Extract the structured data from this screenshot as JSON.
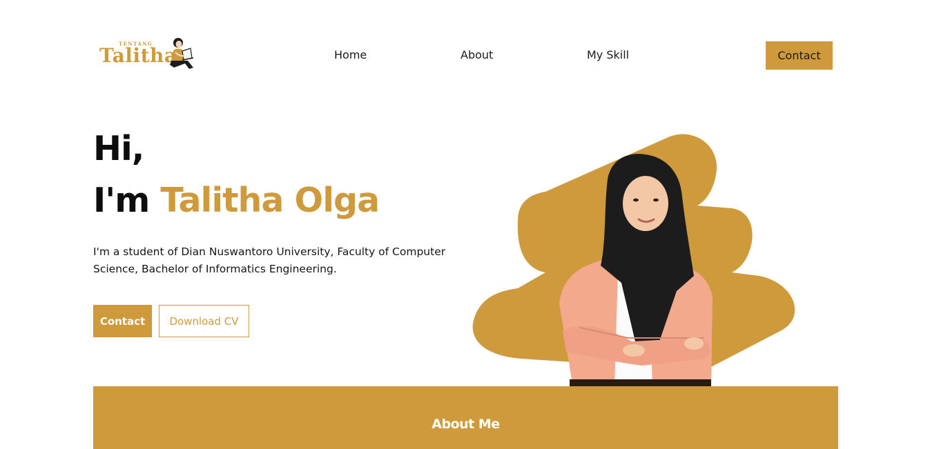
{
  "theme": {
    "accent": "#CF9A3C",
    "text_dark": "#111111",
    "skin": "#F3A98C",
    "hijab": "#1C1C1C"
  },
  "header": {
    "logo_small": "TENTANG",
    "logo_big": "Talitha",
    "logo_icon": "girl-with-laptop-icon",
    "nav": [
      {
        "label": "Home"
      },
      {
        "label": "About"
      },
      {
        "label": "My Skill"
      }
    ],
    "contact_label": "Contact"
  },
  "hero": {
    "greeting": "Hi,",
    "intro_prefix": "I'm",
    "name": "Talitha Olga",
    "description": "I'm a student of Dian Nuswantoro University, Faculty of Computer Science, Bachelor of Informatics Engineering.",
    "contact_label": "Contact",
    "download_label": "Download CV"
  },
  "about": {
    "title": "About Me"
  }
}
